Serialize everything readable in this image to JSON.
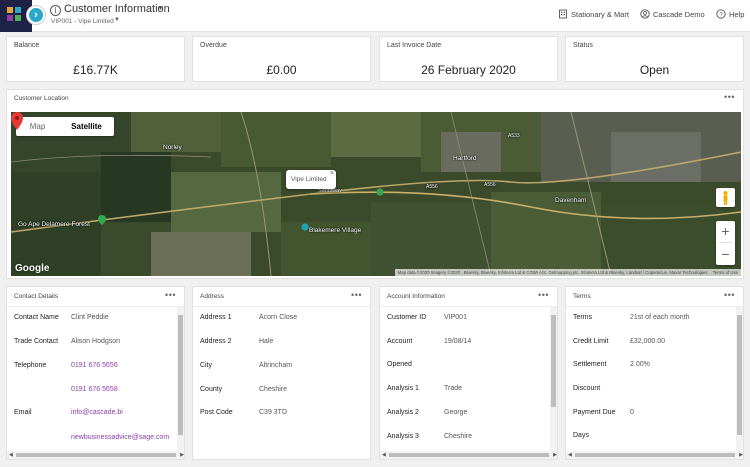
{
  "header": {
    "title": "Customer Information",
    "subtitle": "VIP001 - Vipe Limited",
    "company": "Stationary & Mart",
    "user": "Cascade Demo",
    "help": "Help"
  },
  "kpis": [
    {
      "label": "Balance",
      "value": "£16.77K"
    },
    {
      "label": "Overdue",
      "value": "£0.00"
    },
    {
      "label": "Last Invoice Date",
      "value": "26 February 2020"
    },
    {
      "label": "Status",
      "value": "Open"
    }
  ],
  "location": {
    "title": "Customer Location",
    "map_tab": "Map",
    "satellite_tab": "Satellite",
    "marker_label": "Vipe Limited",
    "places": {
      "norley": "Norley",
      "hartford": "Hartford",
      "davenham": "Davenham",
      "sandiway": "Sandiway",
      "go_ape": "Go Ape Delamere Forest",
      "blakemere": "Blakemere Village",
      "road_a556_1": "A556",
      "road_a556_2": "A556",
      "road_a533": "A533"
    },
    "google": "Google",
    "attribution": "Map data ©2020 Imagery ©2020 , Bluesky, Bluesky, Infoterra Ltd & COWI A/S, Getmapping plc, Infoterra Ltd & Bluesky, Landsat / Copernicus, Maxar Technologies",
    "terms": "Terms of Use"
  },
  "contact": {
    "title": "Contact Details",
    "rows": [
      {
        "label": "Contact Name",
        "value": "Clint Peddie"
      },
      {
        "label": "Trade Contact",
        "value": "Alison Hodgson"
      },
      {
        "label": "Telephone",
        "value": "0191 676 5656"
      },
      {
        "label": "",
        "value": "0191 676 5658"
      },
      {
        "label": "Email",
        "value": "info@cascade.bi"
      },
      {
        "label": "",
        "value": "newbusinessadvice@sage.com"
      }
    ]
  },
  "address": {
    "title": "Address",
    "rows": [
      {
        "label": "Address 1",
        "value": "Acorn Close"
      },
      {
        "label": "Address 2",
        "value": "Hale"
      },
      {
        "label": "City",
        "value": "Altrincham"
      },
      {
        "label": "County",
        "value": "Cheshire"
      },
      {
        "label": "Post Code",
        "value": "C39 3TD"
      }
    ]
  },
  "account": {
    "title": "Account Information",
    "rows": [
      {
        "label": "Customer ID",
        "value": "VIP001"
      },
      {
        "label": "Account",
        "value": "19/08/14"
      },
      {
        "label": "Opened",
        "value": ""
      },
      {
        "label": "Analysis 1",
        "value": "Trade"
      },
      {
        "label": "Analysis 2",
        "value": "George"
      },
      {
        "label": "Analysis 3",
        "value": "Cheshire"
      }
    ]
  },
  "terms": {
    "title": "Terms",
    "rows": [
      {
        "label": "Terms",
        "value": "21st of each month"
      },
      {
        "label": "Credit Limit",
        "value": "£32,000.00"
      },
      {
        "label": "Settlement",
        "value": "2.00%"
      },
      {
        "label": "Discount",
        "value": ""
      },
      {
        "label": "Payment Due",
        "value": "0"
      },
      {
        "label": "Days",
        "value": ""
      }
    ]
  },
  "colors": {
    "logo_bg": "#1e2246",
    "nav_accent": "#2aa7c9",
    "link": "#8b3fa5",
    "marker": "#e53935"
  },
  "icons": [
    "app-logo-icon",
    "forward-chevron-icon",
    "info-icon",
    "building-icon",
    "user-icon",
    "help-icon",
    "more-dots-icon",
    "map-pin-icon",
    "pegman-icon"
  ]
}
